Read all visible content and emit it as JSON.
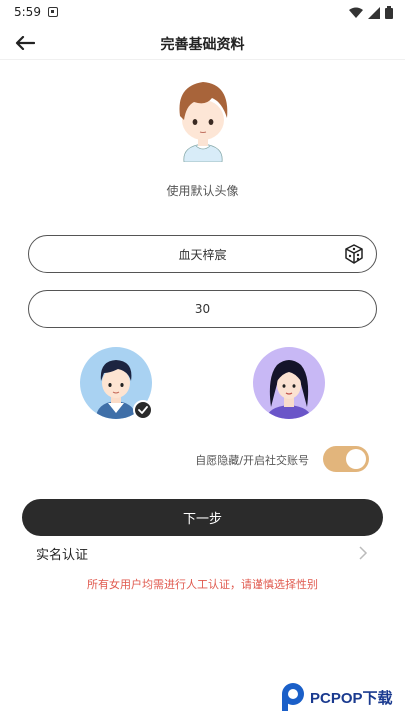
{
  "status_bar": {
    "time": "5:59"
  },
  "header": {
    "title": "完善基础资料"
  },
  "avatar": {
    "label": "使用默认头像"
  },
  "nickname": {
    "value": "血天梓宸"
  },
  "age": {
    "value": "30"
  },
  "gender": {
    "selected": "male"
  },
  "privacy": {
    "label": "自愿隐藏/开启社交账号",
    "enabled": true
  },
  "next_button": {
    "label": "下一步"
  },
  "real_name": {
    "label": "实名认证"
  },
  "notice": {
    "text": "所有女用户均需进行人工认证，请谨慎选择性别"
  },
  "watermark": {
    "text": "PCPOP下载"
  },
  "colors": {
    "toggle_on": "#e2b57c",
    "notice": "#e05a4f",
    "button_dark": "#2b2b2b"
  }
}
